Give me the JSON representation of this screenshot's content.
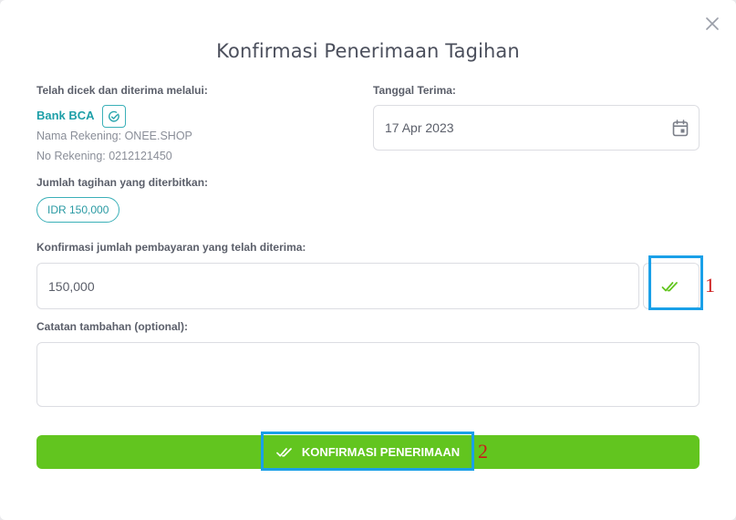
{
  "modal": {
    "title": "Konfirmasi Penerimaan Tagihan",
    "close_icon": "close-icon"
  },
  "received_via": {
    "label": "Telah dicek dan diterima melalui:",
    "bank_name": "Bank BCA",
    "account_name": "Nama Rekening: ONEE.SHOP",
    "account_number": "No Rekening: 0212121450",
    "bank_icon": "check-circle-icon"
  },
  "received_date": {
    "label": "Tanggal Terima:",
    "value": "17 Apr 2023",
    "icon": "calendar-icon"
  },
  "issued_amount": {
    "label": "Jumlah tagihan yang diterbitkan:",
    "value": "IDR 150,000"
  },
  "confirm_amount": {
    "label": "Konfirmasi jumlah pembayaran yang telah diterima:",
    "value": "150,000",
    "check_icon": "double-check-icon"
  },
  "notes": {
    "label": "Catatan tambahan (optional):",
    "value": ""
  },
  "submit": {
    "label": "KONFIRMASI PENERIMAAN",
    "icon": "double-check-icon"
  },
  "annotations": {
    "one": "1",
    "two": "2"
  },
  "colors": {
    "accent_teal": "#1e9fa8",
    "accent_green": "#62c51f",
    "highlight_blue": "#1aa0e8",
    "annotation_red": "#cc1a1a"
  }
}
